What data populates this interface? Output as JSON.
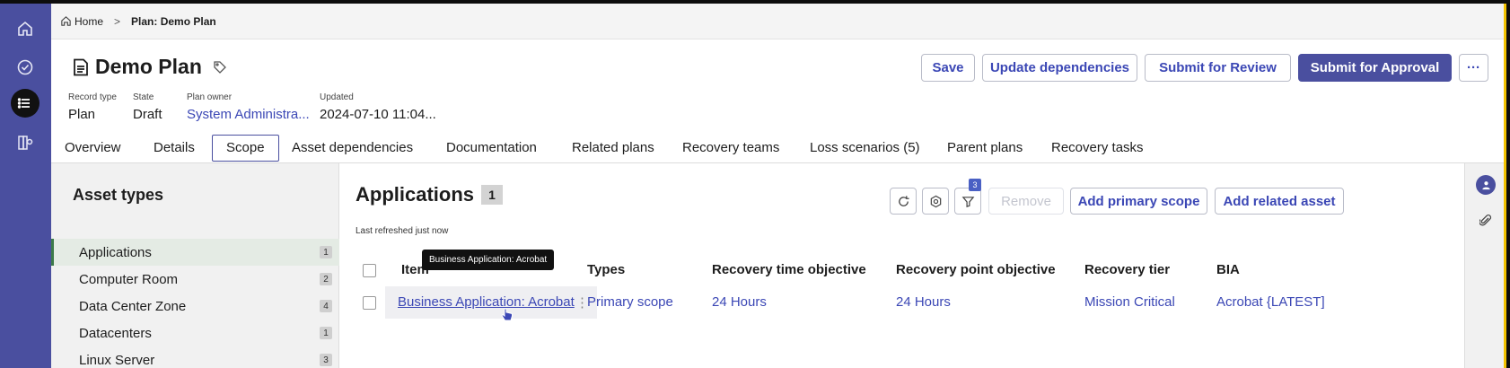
{
  "breadcrumb": {
    "home": "Home",
    "current": "Plan: Demo Plan"
  },
  "plan": {
    "title": "Demo Plan",
    "fields": [
      {
        "label": "Record type",
        "value": "Plan"
      },
      {
        "label": "State",
        "value": "Draft"
      },
      {
        "label": "Plan owner",
        "value": "System Administra..."
      },
      {
        "label": "Updated",
        "value": "2024-07-10 11:04..."
      }
    ]
  },
  "actions": {
    "save": "Save",
    "update_dependencies": "Update dependencies",
    "submit_review": "Submit for Review",
    "submit_approval": "Submit for Approval",
    "more": "···"
  },
  "tabs": [
    "Overview",
    "Details",
    "Scope",
    "Asset dependencies",
    "Documentation",
    "Related plans",
    "Recovery teams",
    "Loss scenarios (5)",
    "Parent plans",
    "Recovery tasks"
  ],
  "active_tab": "Scope",
  "asset_types": {
    "heading": "Asset types",
    "items": [
      {
        "label": "Applications",
        "count": "1"
      },
      {
        "label": "Computer Room",
        "count": "2"
      },
      {
        "label": "Data Center Zone",
        "count": "4"
      },
      {
        "label": "Datacenters",
        "count": "1"
      },
      {
        "label": "Linux Server",
        "count": "3"
      }
    ]
  },
  "applications": {
    "title": "Applications",
    "count": "1",
    "refreshed": "Last refreshed just now",
    "filter_count": "3",
    "remove": "Remove",
    "add_primary": "Add primary scope",
    "add_related": "Add related asset",
    "columns": {
      "item": "Item",
      "types": "Types",
      "rto": "Recovery time objective",
      "rpo": "Recovery point objective",
      "tier": "Recovery tier",
      "bia": "BIA"
    },
    "rows": [
      {
        "item": "Business Application: Acrobat",
        "types": "Primary scope",
        "rto": "24 Hours",
        "rpo": "24 Hours",
        "tier": "Mission Critical",
        "bia": "Acrobat {LATEST]"
      }
    ],
    "tooltip": "Business Application: Acrobat"
  },
  "colors": {
    "rail": "#4a4f9f",
    "link": "#3b47b5",
    "accent_border": "#f3c300"
  }
}
